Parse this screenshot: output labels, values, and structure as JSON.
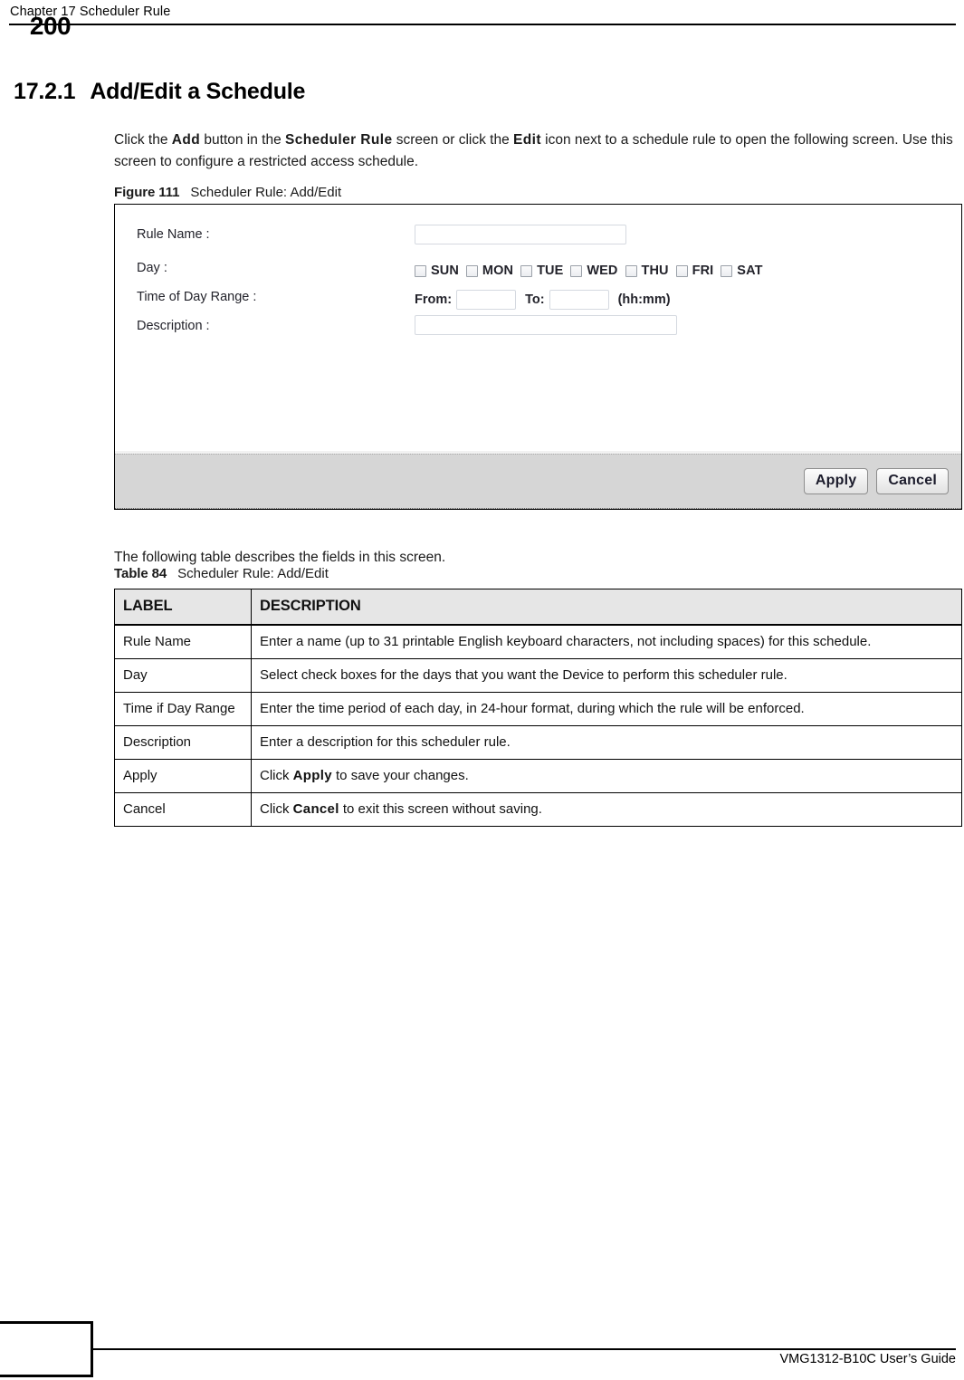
{
  "header": {
    "chapter_title": "Chapter 17 Scheduler Rule"
  },
  "section": {
    "number": "17.2.1",
    "title": "Add/Edit a Schedule"
  },
  "intro_paragraph": {
    "part1": "Click the ",
    "bold1": "Add",
    "part2": " button in the ",
    "bold2": "Scheduler Rule",
    "part3": " screen or click the ",
    "bold3": "Edit",
    "part4": " icon next to a schedule rule to open the following screen. Use this screen to configure a restricted access schedule."
  },
  "figure": {
    "caption_label": "Figure 111",
    "caption_text": "Scheduler Rule: Add/Edit",
    "form": {
      "rule_name_label": "Rule Name :",
      "rule_name_value": "",
      "rule_name_placeholder": "",
      "day_label": "Day :",
      "days": [
        {
          "label": "SUN",
          "checked": false
        },
        {
          "label": "MON",
          "checked": false
        },
        {
          "label": "TUE",
          "checked": false
        },
        {
          "label": "WED",
          "checked": false
        },
        {
          "label": "THU",
          "checked": false
        },
        {
          "label": "FRI",
          "checked": false
        },
        {
          "label": "SAT",
          "checked": false
        }
      ],
      "time_range_label": "Time of Day Range :",
      "time_from_label": "From:",
      "time_from_value": "",
      "time_to_label": "To:",
      "time_to_value": "",
      "time_format_hint": "(hh:mm)",
      "description_label": "Description :",
      "description_value": ""
    },
    "buttons": {
      "apply": "Apply",
      "cancel": "Cancel"
    }
  },
  "table_intro_paragraph": "The following table describes the fields in this screen.",
  "table": {
    "caption_label": "Table 84",
    "caption_text": "Scheduler Rule: Add/Edit",
    "headers": {
      "label": "LABEL",
      "description": "DESCRIPTION"
    },
    "rows": [
      {
        "label": "Rule Name",
        "desc_part1": "Enter a name (up to 31 printable English keyboard characters, not including spaces) for this schedule.",
        "bold": "",
        "desc_part2": ""
      },
      {
        "label": "Day",
        "desc_part1": "Select check boxes for the days that you want the Device to perform this scheduler rule.",
        "bold": "",
        "desc_part2": ""
      },
      {
        "label": "Time if Day Range",
        "desc_part1": "Enter the time period of each day, in 24-hour format, during which the rule will be enforced.",
        "bold": "",
        "desc_part2": ""
      },
      {
        "label": "Description",
        "desc_part1": "Enter a description for this scheduler rule.",
        "bold": "",
        "desc_part2": ""
      },
      {
        "label": "Apply",
        "desc_part1": "Click ",
        "bold": "Apply",
        "desc_part2": " to save your changes."
      },
      {
        "label": "Cancel",
        "desc_part1": "Click ",
        "bold": "Cancel",
        "desc_part2": " to exit this screen without saving."
      }
    ]
  },
  "footer": {
    "page_number": "200",
    "guide_name": "VMG1312-B10C User’s Guide"
  },
  "colors": {
    "figure_footer_bg": "#d6d6d6",
    "table_header_bg": "#e6e6e6",
    "input_border": "#d5d9e0",
    "text": "#000000"
  }
}
